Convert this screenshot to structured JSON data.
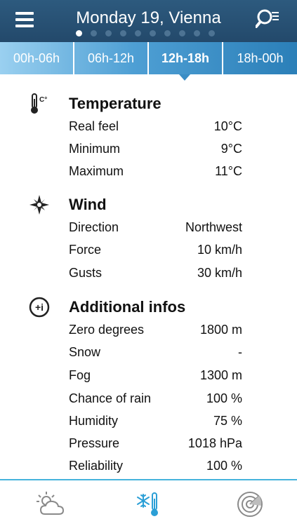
{
  "header": {
    "title": "Monday 19, Vienna",
    "page_dots": 10,
    "active_dot": 0
  },
  "tabs": [
    {
      "label": "00h-06h"
    },
    {
      "label": "06h-12h"
    },
    {
      "label": "12h-18h"
    },
    {
      "label": "18h-00h"
    }
  ],
  "active_tab": 2,
  "sections": {
    "temperature": {
      "icon_label": "C°",
      "title": "Temperature",
      "rows": [
        {
          "label": "Real feel",
          "value": "10°C"
        },
        {
          "label": "Minimum",
          "value": "9°C"
        },
        {
          "label": "Maximum",
          "value": "11°C"
        }
      ]
    },
    "wind": {
      "title": "Wind",
      "rows": [
        {
          "label": "Direction",
          "value": "Northwest"
        },
        {
          "label": "Force",
          "value": "10 km/h"
        },
        {
          "label": "Gusts",
          "value": "30 km/h"
        }
      ]
    },
    "additional": {
      "icon_label": "+i",
      "title": "Additional infos",
      "rows": [
        {
          "label": "Zero degrees",
          "value": "1800 m"
        },
        {
          "label": "Snow",
          "value": "-"
        },
        {
          "label": "Fog",
          "value": "1300 m"
        },
        {
          "label": "Chance of rain",
          "value": "100 %"
        },
        {
          "label": "Humidity",
          "value": "75 %"
        },
        {
          "label": "Pressure",
          "value": "1018 hPa"
        },
        {
          "label": "Reliability",
          "value": "100 %"
        }
      ]
    }
  },
  "bottom_nav": {
    "items": [
      {
        "icon": "partly-cloudy-icon"
      },
      {
        "icon": "snow-thermometer-icon"
      },
      {
        "icon": "radar-icon"
      }
    ],
    "active": 1
  },
  "colors": {
    "header": "#2d5a7e",
    "accent": "#46b3dc",
    "active_icon": "#2b9fd6",
    "inactive_icon": "#8a8a8a"
  }
}
